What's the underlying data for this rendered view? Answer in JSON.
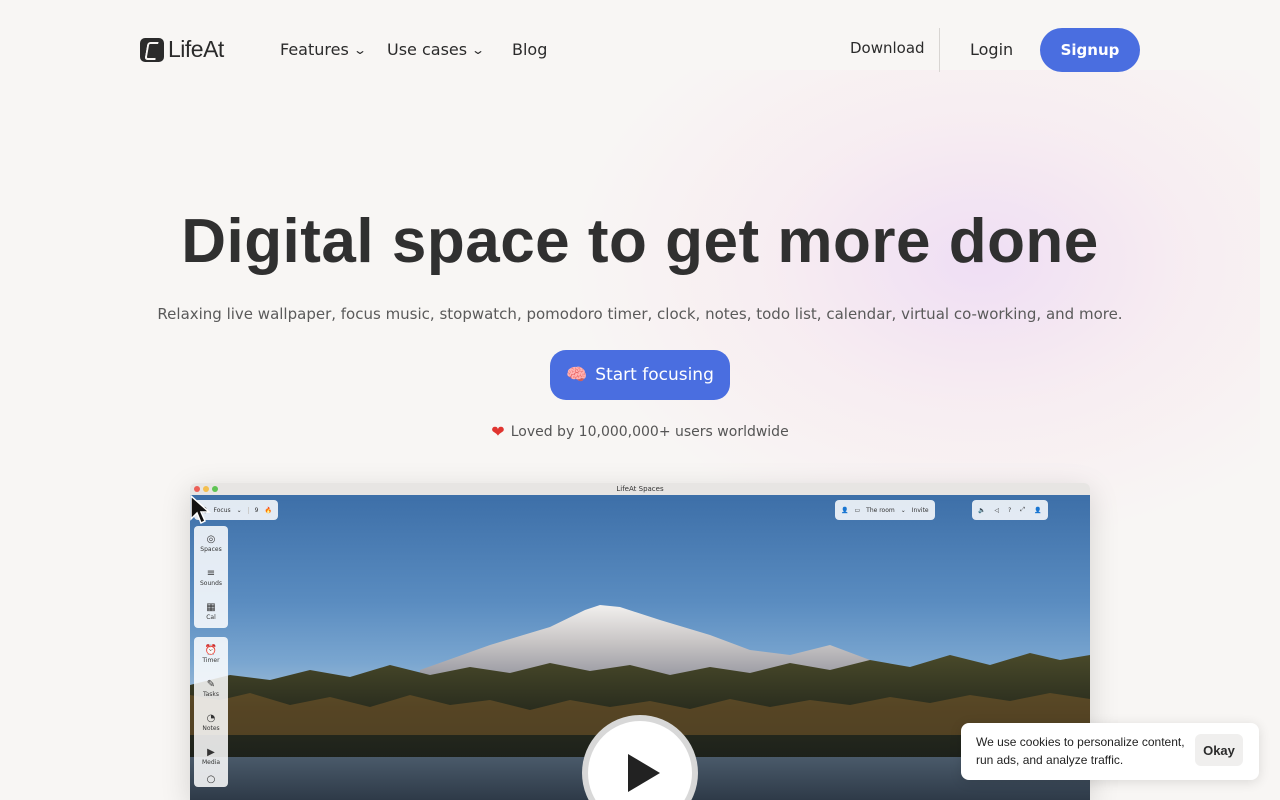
{
  "brand": {
    "name": "LifeAt"
  },
  "nav": {
    "features": "Features",
    "use_cases": "Use cases",
    "blog": "Blog",
    "download": "Download",
    "login": "Login",
    "signup": "Signup"
  },
  "hero": {
    "headline": "Digital space to get more done",
    "subline": "Relaxing live wallpaper, focus music, stopwatch, pomodoro timer, clock, notes, todo list, calendar, virtual co-working, and more.",
    "cta_emoji": "🧠",
    "cta_label": "Start focusing",
    "loved_text": "Loved by 10,000,000+ users worldwide"
  },
  "app_window": {
    "title": "LifeAt Spaces",
    "focus_label": "Focus",
    "streak": "9",
    "room_label": "The room",
    "invite_label": "Invite",
    "sidebar_top": [
      "Spaces",
      "Sounds",
      "Cal"
    ],
    "sidebar_bottom": [
      "Timer",
      "Tasks",
      "Notes",
      "Media"
    ]
  },
  "cookie": {
    "message": "We use cookies to personalize content, run ads, and analyze traffic.",
    "button": "Okay"
  },
  "colors": {
    "accent": "#4a6ee0",
    "background": "#f8f6f4",
    "heart": "#e0342f"
  }
}
